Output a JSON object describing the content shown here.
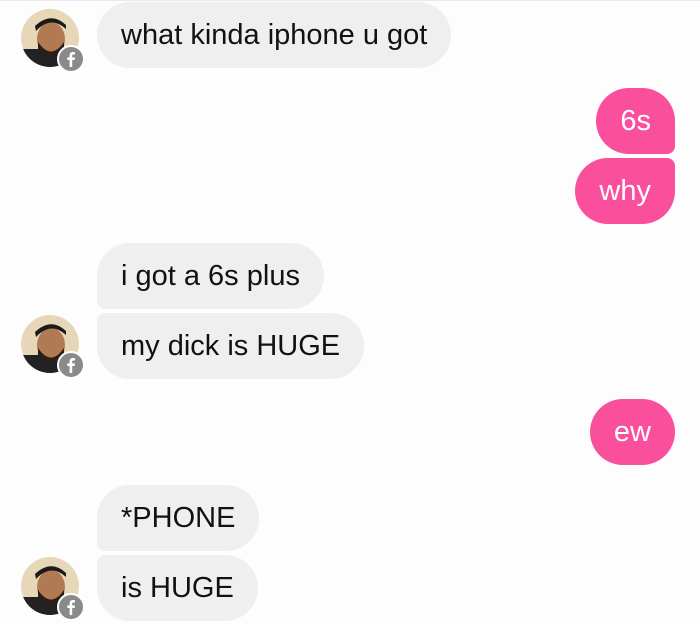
{
  "colors": {
    "incoming_bubble": "#efefef",
    "outgoing_bubble": "#fa4f9c",
    "incoming_text": "#111111",
    "outgoing_text": "#ffffff"
  },
  "messages": [
    {
      "sender": "them",
      "text": "what kinda iphone u got"
    },
    {
      "sender": "me",
      "text": "6s"
    },
    {
      "sender": "me",
      "text": "why"
    },
    {
      "sender": "them",
      "text": "i got a 6s plus"
    },
    {
      "sender": "them",
      "text": "my dick is HUGE"
    },
    {
      "sender": "me",
      "text": "ew"
    },
    {
      "sender": "them",
      "text": "*PHONE"
    },
    {
      "sender": "them",
      "text": "is HUGE"
    }
  ],
  "avatar": {
    "icon": "profile-photo",
    "badge_icon": "facebook-badge-icon"
  }
}
